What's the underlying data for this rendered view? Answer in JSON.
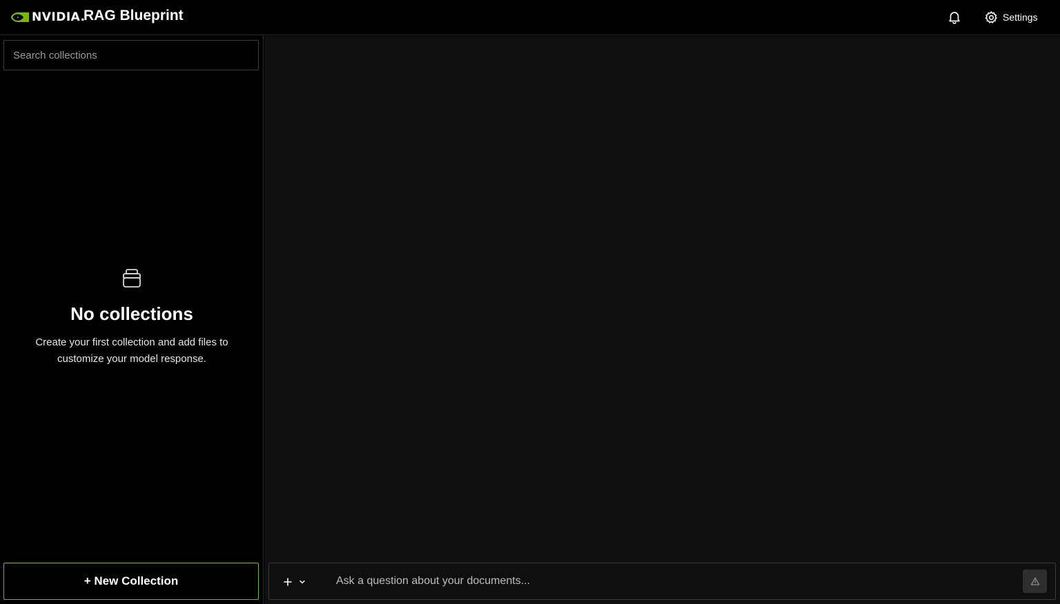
{
  "header": {
    "brand_wordmark": "NVIDIA.",
    "app_title": "RAG Blueprint",
    "notifications_icon": "bell-icon",
    "settings_icon": "gear-icon",
    "settings_label": "Settings"
  },
  "sidebar": {
    "search": {
      "placeholder": "Search collections",
      "value": ""
    },
    "empty_state": {
      "icon": "database-icon",
      "title": "No collections",
      "description": "Create your first collection and add files to customize your model response."
    },
    "new_collection_label": "+ New Collection"
  },
  "chat": {
    "attach_icon": "plus-icon",
    "attach_menu_icon": "chevron-down-icon",
    "input": {
      "placeholder": "Ask a question about your documents...",
      "value": ""
    },
    "send_icon": "send-triangle-icon"
  },
  "colors": {
    "accent": "#76b900",
    "background": "#000000",
    "main_background": "#0f0f0f",
    "border": "#3a3a3a"
  }
}
